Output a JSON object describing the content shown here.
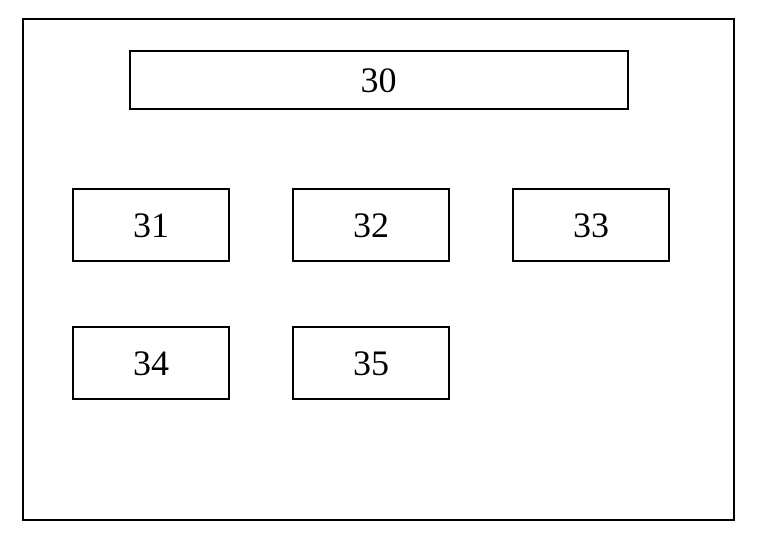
{
  "chart_data": {
    "type": "table",
    "title": "",
    "header": "30",
    "rows": [
      [
        "31",
        "32",
        "33"
      ],
      [
        "34",
        "35"
      ]
    ]
  },
  "header": {
    "label": "30"
  },
  "row1": {
    "items": [
      "31",
      "32",
      "33"
    ]
  },
  "row2": {
    "items": [
      "34",
      "35"
    ]
  }
}
